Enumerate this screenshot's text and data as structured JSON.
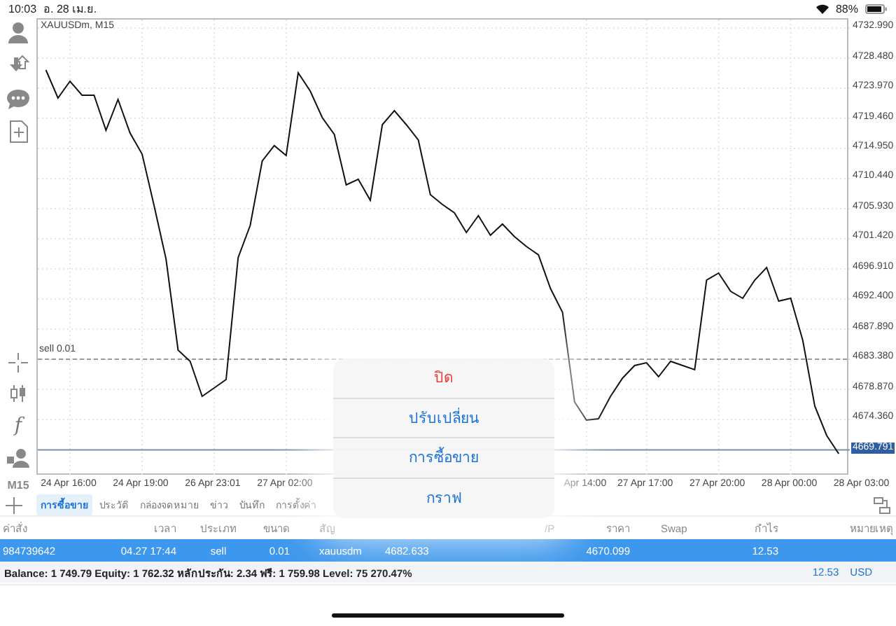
{
  "status_bar": {
    "time": "10:03",
    "date": "อ. 28 เม.ย.",
    "battery": "88%"
  },
  "toolbar": {
    "function_glyph": "f",
    "timeframe": "M15"
  },
  "chart": {
    "chart_data": {
      "type": "line",
      "title": "XAUUSDm, M15",
      "grid": true,
      "categories": [
        null,
        null,
        "24 Apr 16:00",
        null,
        null,
        null,
        null,
        null,
        "24 Apr 19:00",
        null,
        null,
        null,
        null,
        null,
        "26 Apr 23:01",
        null,
        null,
        null,
        null,
        null,
        "27 Apr 02:00",
        null,
        null,
        null,
        null,
        null,
        null,
        null,
        null,
        null,
        null,
        null,
        null,
        null,
        null,
        null,
        null,
        null,
        null,
        null,
        null,
        null,
        null,
        null,
        null,
        "Apr 14:00",
        null,
        null,
        null,
        null,
        "27 Apr 17:00",
        null,
        null,
        null,
        null,
        null,
        "27 Apr 20:00",
        null,
        null,
        null,
        null,
        null,
        "28 Apr 00:00",
        null,
        null,
        null,
        null,
        null,
        "28 Apr 03:00"
      ],
      "ref_lines": [
        {
          "axis": "y",
          "value": 4683.38,
          "label": "sell 0.01"
        },
        {
          "axis": "y",
          "value": 4669.791,
          "label": "4669.791"
        }
      ],
      "ylim": [
        4665.86,
        4734.25
      ],
      "yticks": [
        {
          "value": 4732.99,
          "label": "4732.990"
        },
        {
          "value": 4728.48,
          "label": "4728.480"
        },
        {
          "value": 4723.97,
          "label": "4723.970"
        },
        {
          "value": 4719.46,
          "label": "4719.460"
        },
        {
          "value": 4714.95,
          "label": "4714.950"
        },
        {
          "value": 4710.44,
          "label": "4710.440"
        },
        {
          "value": 4705.93,
          "label": "4705.930"
        },
        {
          "value": 4701.42,
          "label": "4701.420"
        },
        {
          "value": 4696.91,
          "label": "4696.910"
        },
        {
          "value": 4692.4,
          "label": "4692.400"
        },
        {
          "value": 4687.89,
          "label": "4687.890"
        },
        {
          "value": 4683.38,
          "label": "4683.380"
        },
        {
          "value": 4678.87,
          "label": "4678.870"
        },
        {
          "value": 4674.36,
          "label": "4674.360"
        }
      ],
      "series": [
        {
          "color": "#111111",
          "values": [
            4726.7,
            4722.5,
            4725.02,
            4722.92,
            4722.92,
            4717.68,
            4722.29,
            4717.26,
            4714.11,
            4706.35,
            4698.38,
            4684.74,
            4683.06,
            4677.82,
            4679.08,
            4680.34,
            4698.59,
            4703.41,
            4713.06,
            4715.37,
            4713.9,
            4726.28,
            4723.55,
            4719.56,
            4717.05,
            4709.5,
            4710.33,
            4707.19,
            4718.52,
            4720.61,
            4718.52,
            4716.21,
            4708.03,
            4706.56,
            4705.3,
            4702.36,
            4704.88,
            4701.94,
            4703.62,
            4701.73,
            4700.27,
            4699.01,
            4693.97,
            4690.41,
            4676.98,
            4674.25,
            4674.46,
            4677.82,
            4680.55,
            4682.43,
            4682.85,
            4680.76,
            4683.06,
            4682.43,
            4681.81,
            4695.23,
            4696.28,
            4693.55,
            4692.5,
            4695.23,
            4697.12,
            4692.08,
            4692.5,
            4686.21,
            4676.35,
            4671.95,
            4669.22,
            null,
            null
          ]
        }
      ]
    }
  },
  "tabs": [
    {
      "label": "การซื้อขาย",
      "selected": true
    },
    {
      "label": "ประวัติ",
      "selected": false
    },
    {
      "label": "กล่องจดหมาย",
      "selected": false
    },
    {
      "label": "ข่าว",
      "selected": false
    },
    {
      "label": "บันทึก",
      "selected": false
    },
    {
      "label": "การตั้งค่า",
      "selected": false
    }
  ],
  "table": {
    "columns": [
      "ค่าสั่ง",
      "เวลา",
      "ประเภท",
      "ขนาด",
      "สัญ",
      null,
      null,
      "/P",
      "ราคา",
      "Swap",
      "กำไร",
      "หมายเหตุ"
    ],
    "rows": [
      {
        "selected": true,
        "cells": [
          "984739642",
          "04.27 17:44",
          "sell",
          "0.01",
          "xauusdm",
          "4682.633",
          null,
          null,
          "4670.099",
          null,
          "12.53",
          null
        ]
      }
    ]
  },
  "summary": {
    "text": "Balance: 1 749.79 Equity: 1 762.32 หลักประกัน: 2.34 ฟรี: 1 759.98 Level: 75 270.47%",
    "profit": "12.53",
    "currency": "USD"
  },
  "popup_menu": [
    {
      "label": "ปิด",
      "kind": "destructive"
    },
    {
      "label": "ปรับเปลี่ยน",
      "kind": "action"
    },
    {
      "label": "การซื้อขาย",
      "kind": "action"
    },
    {
      "label": "กราฟ",
      "kind": "action"
    }
  ]
}
